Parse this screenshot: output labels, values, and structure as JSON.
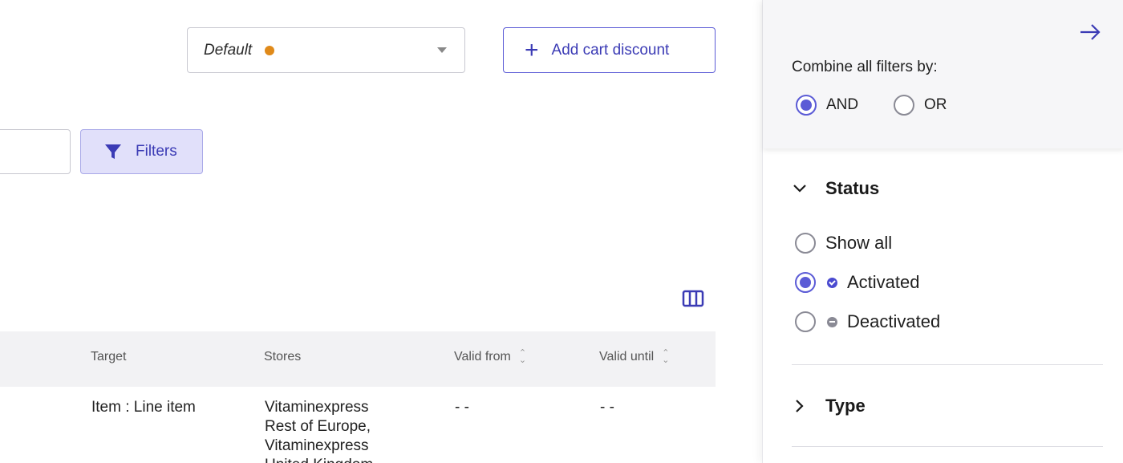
{
  "toolbar": {
    "view_value": "Default",
    "view_dot_color": "#e08a1a",
    "add_label": "Add cart discount",
    "filters_label": "Filters"
  },
  "table": {
    "columns": [
      "Target",
      "Stores",
      "Valid from",
      "Valid until"
    ],
    "rows": [
      {
        "target": "Item : Line item",
        "stores": [
          "Vitaminexpress",
          "Rest of Europe,",
          "Vitaminexpress",
          "United Kingdom"
        ],
        "valid_from": "- -",
        "valid_until": "- -"
      }
    ]
  },
  "panel": {
    "combine_label": "Combine all filters by:",
    "combine_options": [
      {
        "label": "AND",
        "selected": true
      },
      {
        "label": "OR",
        "selected": false
      }
    ],
    "status": {
      "title": "Status",
      "expanded": true,
      "options": [
        {
          "label": "Show all",
          "selected": false
        },
        {
          "label": "Activated",
          "selected": true,
          "icon": "check-circle-icon"
        },
        {
          "label": "Deactivated",
          "selected": false,
          "icon": "minus-circle-icon"
        }
      ]
    },
    "type": {
      "title": "Type",
      "expanded": false
    }
  },
  "colors": {
    "accent": "#5b5bd6",
    "accent_text": "#3b3bb5",
    "filters_bg": "#e1e0fa"
  }
}
